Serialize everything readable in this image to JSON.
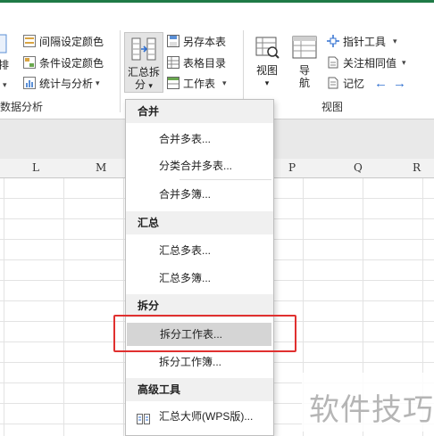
{
  "ribbon": {
    "left_cut_big_label": "排",
    "left_group_label": "数据分析",
    "color_small": [
      {
        "label": "间隔设定颜色",
        "icon": "interval-color-icon"
      },
      {
        "label": "条件设定颜色",
        "icon": "condition-color-icon"
      },
      {
        "label": "统计与分析",
        "icon": "statistics-icon"
      }
    ],
    "split_big": {
      "line1": "汇总拆",
      "line2": "分"
    },
    "table_small": [
      {
        "label": "另存本表",
        "icon": "save-sheet-icon"
      },
      {
        "label": "表格目录",
        "icon": "table-directory-icon"
      },
      {
        "label": "工作表",
        "icon": "worksheet-icon"
      }
    ],
    "view_big": [
      {
        "label": "视图",
        "icon": "view-icon"
      },
      {
        "label1": "导",
        "label2": "航",
        "icon": "navigation-icon"
      }
    ],
    "right_small": [
      {
        "label": "指针工具",
        "icon": "pointer-tool-icon"
      },
      {
        "label": "关注相同值",
        "icon": "same-value-icon"
      },
      {
        "label": "记忆",
        "icon": "memory-icon"
      }
    ],
    "view_group_label": "视图"
  },
  "columns": [
    "L",
    "M",
    "P",
    "Q",
    "R"
  ],
  "menu": {
    "sections": [
      {
        "header": "合并",
        "items": [
          "合并多表...",
          "分类合并多表...",
          "合并多簿..."
        ]
      },
      {
        "header": "汇总",
        "items": [
          "汇总多表...",
          "汇总多簿..."
        ]
      },
      {
        "header": "拆分",
        "items": [
          "拆分工作表...",
          "拆分工作簿..."
        ]
      },
      {
        "header": "高级工具",
        "items": [
          "汇总大师(WPS版)..."
        ]
      }
    ],
    "highlighted": "拆分工作表..."
  },
  "watermark": "软件技巧",
  "colors": {
    "accent_green": "#1f7a46",
    "highlight_red": "#e0302f",
    "arrow_blue": "#2f6fd0"
  }
}
